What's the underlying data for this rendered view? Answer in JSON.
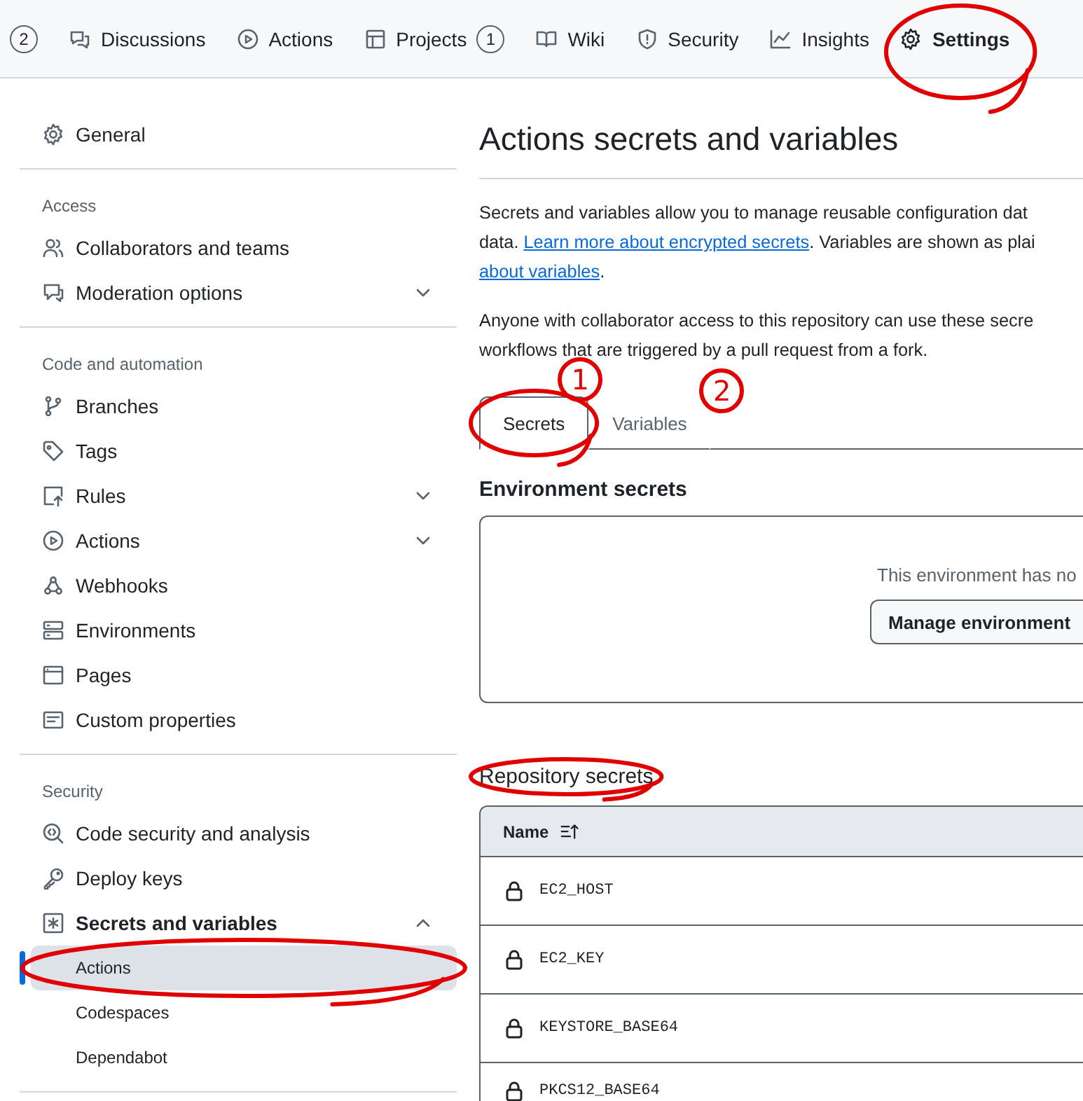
{
  "nav": {
    "items": [
      {
        "count": "2",
        "selected": false,
        "circled": false
      },
      {
        "label": "Discussions",
        "selected": false,
        "circled": false
      },
      {
        "label": "Actions",
        "selected": false,
        "circled": false
      },
      {
        "label": "Projects",
        "count": "1",
        "selected": false,
        "circled": false
      },
      {
        "label": "Wiki",
        "selected": false,
        "circled": false
      },
      {
        "label": "Security",
        "selected": false,
        "circled": false
      },
      {
        "label": "Insights",
        "selected": false,
        "circled": false
      },
      {
        "label": "Settings",
        "selected": true,
        "circled": true
      }
    ]
  },
  "sidebar": {
    "sections": [
      {
        "items": [
          {
            "label": "General"
          }
        ]
      },
      {
        "heading": "Access",
        "items": [
          {
            "label": "Collaborators and teams"
          },
          {
            "label": "Moderation options",
            "expanded": false
          }
        ]
      },
      {
        "heading": "Code and automation",
        "items": [
          {
            "label": "Branches"
          },
          {
            "label": "Tags"
          },
          {
            "label": "Rules",
            "expanded": false
          },
          {
            "label": "Actions",
            "expanded": false
          },
          {
            "label": "Webhooks"
          },
          {
            "label": "Environments"
          },
          {
            "label": "Pages"
          },
          {
            "label": "Custom properties"
          }
        ]
      },
      {
        "heading": "Security",
        "items": [
          {
            "label": "Code security and analysis"
          },
          {
            "label": "Deploy keys"
          },
          {
            "label": "Secrets and variables",
            "expanded": true,
            "children": [
              {
                "label": "Actions",
                "selected": true,
                "circled": true
              },
              {
                "label": "Codespaces",
                "selected": false,
                "circled": false
              },
              {
                "label": "Dependabot",
                "selected": false,
                "circled": false
              }
            ]
          }
        ]
      }
    ]
  },
  "main": {
    "title": "Actions secrets and variables",
    "paragraphs": [
      {
        "lines": [
          [
            {
              "text": "Secrets and variables allow you to manage reusable configuration dat"
            }
          ],
          [
            {
              "text": "data. "
            },
            {
              "text": "Learn more about encrypted secrets",
              "link": true
            },
            {
              "text": ". Variables are shown as plai"
            }
          ],
          [
            {
              "text": "about variables",
              "link": true
            },
            {
              "text": "."
            }
          ]
        ]
      },
      {
        "lines": [
          [
            {
              "text": "Anyone with collaborator access to this repository can use these secre"
            }
          ],
          [
            {
              "text": "workflows that are triggered by a pull request from a fork."
            }
          ]
        ]
      }
    ],
    "tabs": [
      {
        "label": "Secrets",
        "selected": true,
        "circled": true,
        "note": "1"
      },
      {
        "label": "Variables",
        "selected": false,
        "circled": false,
        "note": "2"
      }
    ],
    "environment_secrets": {
      "title": "Environment secrets",
      "message": "This environment has no",
      "button": "Manage environment"
    },
    "repository_secrets": {
      "title": "Repository secrets",
      "circled": true,
      "columns": [
        {
          "label": "Name",
          "sorted": true
        }
      ],
      "rows": [
        {
          "name": "EC2_HOST"
        },
        {
          "name": "EC2_KEY"
        },
        {
          "name": "KEYSTORE_BASE64"
        },
        {
          "name": "PKCS12_BASE64"
        }
      ]
    }
  }
}
